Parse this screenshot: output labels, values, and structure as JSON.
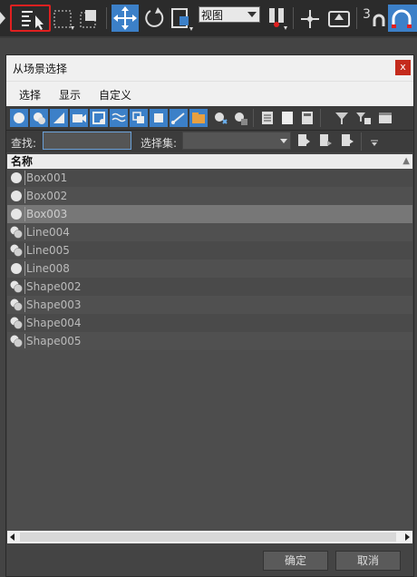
{
  "toolbar": {
    "view_dropdown": "视图",
    "snap_label": "3",
    "accent_color": "#3c80c8",
    "highlight_color": "#e02020"
  },
  "dialog": {
    "title": "从场景选择",
    "close_label": "x",
    "menu": [
      "选择",
      "显示",
      "自定义"
    ],
    "find_label": "查找:",
    "find_value": "",
    "selection_set_label": "选择集:",
    "selection_set_value": "",
    "column_header": "名称",
    "items": [
      {
        "name": "Box001",
        "icon": "sphere-icon",
        "selected": false
      },
      {
        "name": "Box002",
        "icon": "sphere-icon",
        "selected": false
      },
      {
        "name": "Box003",
        "icon": "sphere-icon",
        "selected": true
      },
      {
        "name": "Line004",
        "icon": "shape-icon",
        "selected": false
      },
      {
        "name": "Line005",
        "icon": "shape-icon",
        "selected": false
      },
      {
        "name": "Line008",
        "icon": "sphere-icon",
        "selected": false
      },
      {
        "name": "Shape002",
        "icon": "shape-icon",
        "selected": false
      },
      {
        "name": "Shape003",
        "icon": "shape-icon",
        "selected": false
      },
      {
        "name": "Shape004",
        "icon": "shape-icon",
        "selected": false
      },
      {
        "name": "Shape005",
        "icon": "shape-icon",
        "selected": false
      }
    ],
    "ok_label": "确定",
    "cancel_label": "取消"
  }
}
